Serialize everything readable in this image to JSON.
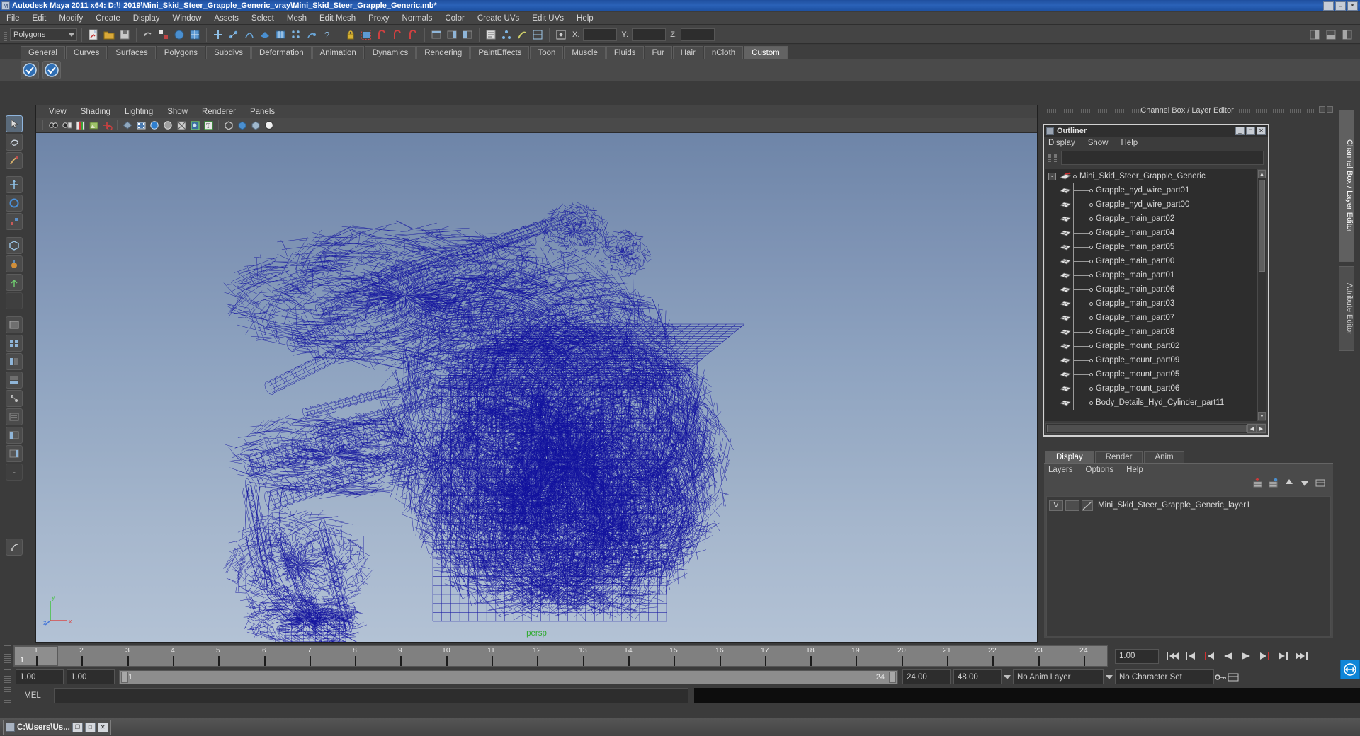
{
  "window": {
    "title": "Autodesk Maya 2011 x64: D:\\! 2019\\Mini_Skid_Steer_Grapple_Generic_vray\\Mini_Skid_Steer_Grapple_Generic.mb*",
    "minimize": "_",
    "maximize": "□",
    "close": "✕"
  },
  "menubar": {
    "items": [
      "File",
      "Edit",
      "Modify",
      "Create",
      "Display",
      "Window",
      "Assets",
      "Select",
      "Mesh",
      "Edit Mesh",
      "Proxy",
      "Normals",
      "Color",
      "Create UVs",
      "Edit UVs",
      "Help"
    ]
  },
  "statusline": {
    "selection_mode": "Polygons",
    "x_label": "X:",
    "y_label": "Y:",
    "z_label": "Z:",
    "x_value": "",
    "y_value": "",
    "z_value": ""
  },
  "shelf": {
    "tabs": [
      "General",
      "Curves",
      "Surfaces",
      "Polygons",
      "Subdivs",
      "Deformation",
      "Animation",
      "Dynamics",
      "Rendering",
      "PaintEffects",
      "Toon",
      "Muscle",
      "Fluids",
      "Fur",
      "Hair",
      "nCloth",
      "Custom"
    ],
    "active_tab": "Custom",
    "icon_names": [
      "vray-render-icon",
      "vray-rt-icon"
    ]
  },
  "viewport": {
    "menus": [
      "View",
      "Shading",
      "Lighting",
      "Show",
      "Renderer",
      "Panels"
    ],
    "camera_label": "persp",
    "axis": {
      "x": "x",
      "y": "y",
      "z": "z"
    },
    "model_color": "#11119e"
  },
  "dock": {
    "title": "Channel Box / Layer Editor"
  },
  "outliner": {
    "title": "Outliner",
    "menus": [
      "Display",
      "Show",
      "Help"
    ],
    "search_value": "",
    "root": "Mini_Skid_Steer_Grapple_Generic",
    "items": [
      "Grapple_hyd_wire_part01",
      "Grapple_hyd_wire_part00",
      "Grapple_main_part02",
      "Grapple_main_part04",
      "Grapple_main_part05",
      "Grapple_main_part00",
      "Grapple_main_part01",
      "Grapple_main_part06",
      "Grapple_main_part03",
      "Grapple_main_part07",
      "Grapple_main_part08",
      "Grapple_mount_part02",
      "Grapple_mount_part09",
      "Grapple_mount_part05",
      "Grapple_mount_part06",
      "Body_Details_Hyd_Cylinder_part11"
    ]
  },
  "layer_editor": {
    "tabs": [
      "Display",
      "Render",
      "Anim"
    ],
    "active_tab": "Display",
    "menus": [
      "Layers",
      "Options",
      "Help"
    ],
    "layers": [
      {
        "visibility": "V",
        "type": "",
        "name": "Mini_Skid_Steer_Grapple_Generic_layer1"
      }
    ]
  },
  "right_tabs": {
    "items": [
      "Channel Box / Layer Editor",
      "Attribute Editor"
    ],
    "active": "Channel Box / Layer Editor"
  },
  "timeslider": {
    "ticks": [
      "1",
      "2",
      "3",
      "4",
      "5",
      "6",
      "7",
      "8",
      "9",
      "10",
      "11",
      "12",
      "13",
      "14",
      "15",
      "16",
      "17",
      "18",
      "19",
      "20",
      "21",
      "22",
      "23",
      "24"
    ],
    "current_frame": "1",
    "current_frame_field": "1.00",
    "playback_buttons": [
      "go-to-start",
      "step-back-keyframe",
      "step-back-frame",
      "play-backwards",
      "play-forwards",
      "step-forward-frame",
      "step-forward-keyframe",
      "go-to-end"
    ]
  },
  "rangeslider": {
    "anim_start": "1.00",
    "range_start": "1.00",
    "bar_start": "1",
    "bar_end": "24",
    "range_end": "24.00",
    "anim_end": "48.00",
    "anim_layer": "No Anim Layer",
    "character_set": "No Character Set"
  },
  "command_line": {
    "label": "MEL",
    "value": ""
  },
  "taskbar": {
    "item_title": "C:\\Users\\Us...",
    "restore": "❐",
    "maximize": "□",
    "close": "✕"
  }
}
